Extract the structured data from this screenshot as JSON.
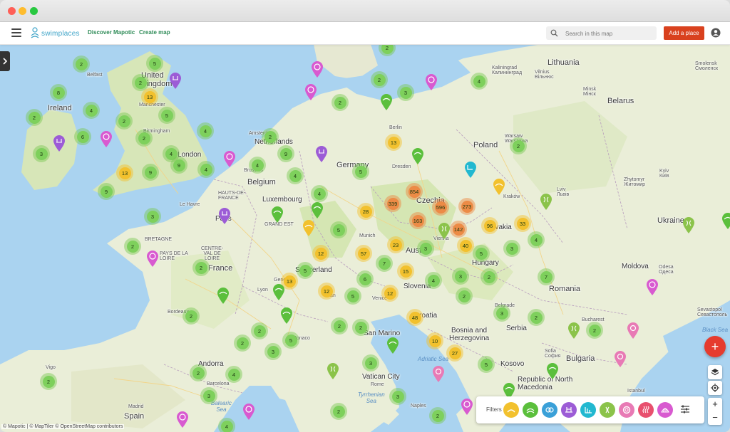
{
  "app": {
    "name": "swimplaces"
  },
  "nav": {
    "discover": "Discover Mapotic",
    "create": "Create map"
  },
  "search": {
    "placeholder": "Search in this map"
  },
  "add_place": "Add a place",
  "attribution": "© Mapotic | © MapTiler © OpenStreetMap contributors",
  "filters": {
    "label": "Filters",
    "colors": [
      "#f2c12e",
      "#5bbf3c",
      "#3aa0d8",
      "#9c5cd6",
      "#22b8d0",
      "#8bc34a",
      "#e87ab5",
      "#e8506e",
      "#d85ad0"
    ]
  },
  "colors": {
    "accent": "#d9411e",
    "green_cluster": "#7ed05c",
    "yellow_cluster": "#f2c12e",
    "orange_cluster": "#ec8b46",
    "land": "#f1eee6",
    "water": "#aad3f0"
  },
  "labels": {
    "lithuania": "Lithuania",
    "vilnius": "Vilnius\nВільнюс",
    "minsk": "Minsk\nМінск",
    "kaliningrad": "Kaliningrad\nКалининград",
    "smolensk": "Smolensk\nСмоленск",
    "belarus": "Belarus",
    "ireland": "Ireland",
    "belfast": "Belfast",
    "united_kingdom": "United\nKingdom",
    "manchester": "Manchester",
    "birmingham": "Birmingham",
    "london": "London",
    "amsterdam": "Amsterdam",
    "netherlands": "Netherlands",
    "berlin": "Berlin",
    "warsaw": "Warsaw\nWarszawa",
    "poland": "Poland",
    "germany": "Germany",
    "dresden": "Dresden",
    "brussels": "Brussels",
    "belgium": "Belgium",
    "luxembourg": "Luxembourg",
    "kyiv": "Kyiv\nКиїв",
    "zhytomyr": "Zhytomyr\nЖитомир",
    "hauts": "HAUTS-DE-\nFRANCE",
    "lehavre": "Le Havre",
    "paris": "Paris",
    "grandest": "GRAND EST",
    "czechia": "Czechia",
    "krakow": "Kraków",
    "lviv": "Lviv\nЛьвів",
    "ukraine": "Ukraine",
    "bretagne": "BRETAGNE",
    "paysdelaloire": "PAYS DE LA\nLOIRE",
    "centre": "CENTRE-\nVAL DE\nLOIRE",
    "france": "France",
    "munich": "Munich",
    "austria": "Austria",
    "vienna": "Vienna",
    "slovakia": "Slovakia",
    "hungary": "Hungary",
    "switzerland": "Switzerland",
    "moldova": "Moldova",
    "odesa": "Odesa\nОдеса",
    "lyon": "Lyon",
    "geneva": "Geneva",
    "milan": "Milan",
    "slovenia": "Slovenia",
    "romania": "Romania",
    "venice": "Venice",
    "croatia": "Croatia",
    "bordeaux": "Bordeaux",
    "monaco": "Monaco",
    "sanmarino": "San Marino",
    "bosnia": "Bosnia and\nHerzegovina",
    "serbia": "Serbia",
    "belgrade": "Belgrade",
    "bucharest": "Bucharest",
    "sevastopol": "Sevastopol\nСевастополь",
    "blacksea": "Black Sea",
    "adriatic": "Adriatic Sea",
    "kosovo": "Kosovo",
    "sofia": "Sofia\nСофия",
    "bulgaria": "Bulgaria",
    "vigo": "Vigo",
    "andorra": "Andorra",
    "barcelona": "Barcelona",
    "vatican": "Vatican City",
    "rome": "Rome",
    "northmacedonia": "Republic of North\nMacedonia",
    "istanbul": "Istanbul",
    "balearic": "Balearic\nSea",
    "tyrrhenian": "Tyrrhenian\nSea",
    "madrid": "Madrid",
    "spain": "Spain",
    "naples": "Naples"
  },
  "clusters": [
    "2",
    "5",
    "2",
    "8",
    "2",
    "2",
    "3",
    "2",
    "4",
    "2",
    "4",
    "5",
    "2",
    "2",
    "3",
    "13",
    "2",
    "4",
    "4",
    "5",
    "6",
    "8",
    "9",
    "2",
    "2",
    "3",
    "8",
    "13",
    "4",
    "9",
    "4",
    "2",
    "3",
    "9",
    "9",
    "4",
    "13",
    "9",
    "4",
    "5",
    "9",
    "4",
    "4",
    "5",
    "5",
    "854",
    "339",
    "596",
    "273",
    "28",
    "163",
    "142",
    "96",
    "33",
    "3",
    "2",
    "5",
    "5",
    "12",
    "23",
    "57",
    "40",
    "5",
    "3",
    "4",
    "2",
    "3",
    "7",
    "3",
    "5",
    "12",
    "15",
    "4",
    "5",
    "2",
    "5",
    "13",
    "6",
    "3",
    "5",
    "4",
    "12",
    "12",
    "3",
    "7",
    "2",
    "2",
    "3",
    "6",
    "2",
    "2",
    "2",
    "5",
    "2",
    "2",
    "2",
    "48",
    "2",
    "3",
    "10",
    "2",
    "2",
    "27",
    "3",
    "5",
    "2",
    "2",
    "4",
    "4",
    "2",
    "3",
    "5",
    "2",
    "3",
    "2",
    "3",
    "2",
    "2",
    "2",
    "6",
    "3",
    "4",
    "2",
    "2",
    "2"
  ]
}
